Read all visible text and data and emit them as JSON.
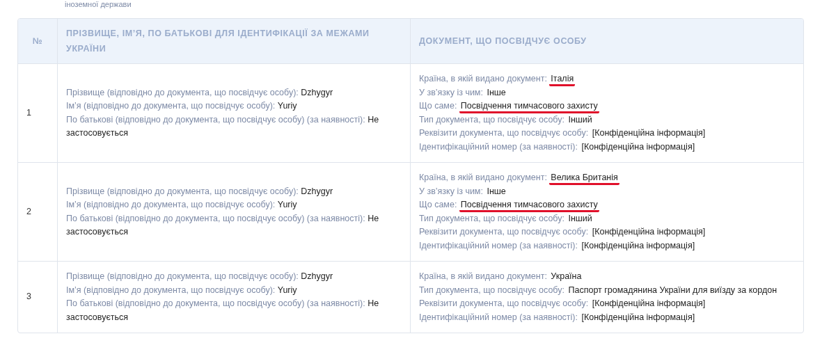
{
  "caption": "іноземної держави",
  "table": {
    "columns": [
      "№",
      "ПРІЗВИЩЕ, ІМ’Я, ПО БАТЬКОВІ ДЛЯ ІДЕНТИФІКАЦІЇ ЗА МЕЖАМИ УКРАЇНИ",
      "ДОКУМЕНТ, ЩО ПОСВІДЧУЄ ОСОБУ"
    ],
    "rows": [
      {
        "number": "1",
        "names": [
          {
            "label": "Прізвище (відповідно до документа, що посвідчує особу):",
            "value": "Dzhygyr"
          },
          {
            "label": "Ім’я (відповідно до документа, що посвідчує особу):",
            "value": "Yuriy"
          },
          {
            "label": "По батькові (відповідно до документа, що посвідчує особу) (за наявності):",
            "value": "Не застосовується"
          }
        ],
        "document": [
          {
            "label": "Країна, в якій видано документ:",
            "value": "Італія",
            "underlined": true
          },
          {
            "label": "У зв’язку із чим:",
            "value": "Інше",
            "underlined": false
          },
          {
            "label": "Що саме:",
            "value": "Посвідчення тимчасового захисту",
            "underlined": true
          },
          {
            "label": "Тип документа, що посвідчує особу:",
            "value": "Інший",
            "underlined": false
          },
          {
            "label": "Реквізити документа, що посвідчує особу:",
            "value": "[Конфіденційна інформація]",
            "underlined": false
          },
          {
            "label": "Ідентифікаційний номер (за наявності):",
            "value": "[Конфіденційна інформація]",
            "underlined": false
          }
        ]
      },
      {
        "number": "2",
        "names": [
          {
            "label": "Прізвище (відповідно до документа, що посвідчує особу):",
            "value": "Dzhygyr"
          },
          {
            "label": "Ім’я (відповідно до документа, що посвідчує особу):",
            "value": "Yuriy"
          },
          {
            "label": "По батькові (відповідно до документа, що посвідчує особу) (за наявності):",
            "value": "Не застосовується"
          }
        ],
        "document": [
          {
            "label": "Країна, в якій видано документ:",
            "value": "Велика Британія",
            "underlined": true
          },
          {
            "label": "У зв’язку із чим:",
            "value": "Інше",
            "underlined": false
          },
          {
            "label": "Що саме:",
            "value": "Посвідчення тимчасового захисту",
            "underlined": true
          },
          {
            "label": "Тип документа, що посвідчує особу:",
            "value": "Інший",
            "underlined": false
          },
          {
            "label": "Реквізити документа, що посвідчує особу:",
            "value": "[Конфіденційна інформація]",
            "underlined": false
          },
          {
            "label": "Ідентифікаційний номер (за наявності):",
            "value": "[Конфіденційна інформація]",
            "underlined": false
          }
        ]
      },
      {
        "number": "3",
        "names": [
          {
            "label": "Прізвище (відповідно до документа, що посвідчує особу):",
            "value": "Dzhygyr"
          },
          {
            "label": "Ім’я (відповідно до документа, що посвідчує особу):",
            "value": "Yuriy"
          },
          {
            "label": "По батькові (відповідно до документа, що посвідчує особу) (за наявності):",
            "value": "Не застосовується"
          }
        ],
        "document": [
          {
            "label": "Країна, в якій видано документ:",
            "value": "Україна",
            "underlined": false
          },
          {
            "label": "Тип документа, що посвідчує особу:",
            "value": "Паспорт громадянина України для виїзду за кордон",
            "underlined": false
          },
          {
            "label": "Реквізити документа, що посвідчує особу:",
            "value": "[Конфіденційна інформація]",
            "underlined": false
          },
          {
            "label": "Ідентифікаційний номер (за наявності):",
            "value": "[Конфіденційна інформація]",
            "underlined": false
          }
        ]
      }
    ]
  }
}
